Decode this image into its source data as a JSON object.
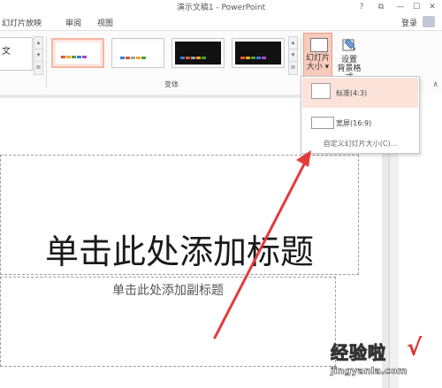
{
  "window": {
    "title": "演示文稿1 - PowerPoint",
    "help": "?",
    "minimize": "—",
    "restore": "⧉",
    "close": "✕"
  },
  "menu": {
    "tabs": [
      "幻灯片放映",
      "审阅",
      "视图"
    ],
    "login": "登录"
  },
  "ribbon": {
    "theme_partial_text": "文",
    "variants_group_label": "变体",
    "variants": [
      {
        "bg": "#ffffff",
        "selected": true
      },
      {
        "bg": "#ffffff",
        "selected": false
      },
      {
        "bg": "#111111",
        "selected": false
      },
      {
        "bg": "#111111",
        "selected": false
      }
    ],
    "variant_bar_colors": [
      "#e4572e",
      "#f3a712",
      "#4e9f3d",
      "#3b7dd8",
      "#a64ac9"
    ],
    "slide_size_button": {
      "line1": "幻灯片",
      "line2": "大小 ▾"
    },
    "format_bg_button": {
      "line1": "设置",
      "line2": "背景格式"
    },
    "collapse_icon": "∧"
  },
  "dropdown": {
    "items": [
      {
        "label": "标准(4:3)"
      },
      {
        "label": "宽屏(16:9)"
      }
    ],
    "custom_link": "自定义幻灯片大小(C)..."
  },
  "slide": {
    "title_placeholder": "单击此处添加标题",
    "subtitle_placeholder": "单击此处添加副标题"
  },
  "watermark": {
    "text": "经验啦",
    "check": "√",
    "url": "jingyanla.com"
  },
  "colors": {
    "accent": "#f8cbbd",
    "arrow": "#e23b3b"
  }
}
